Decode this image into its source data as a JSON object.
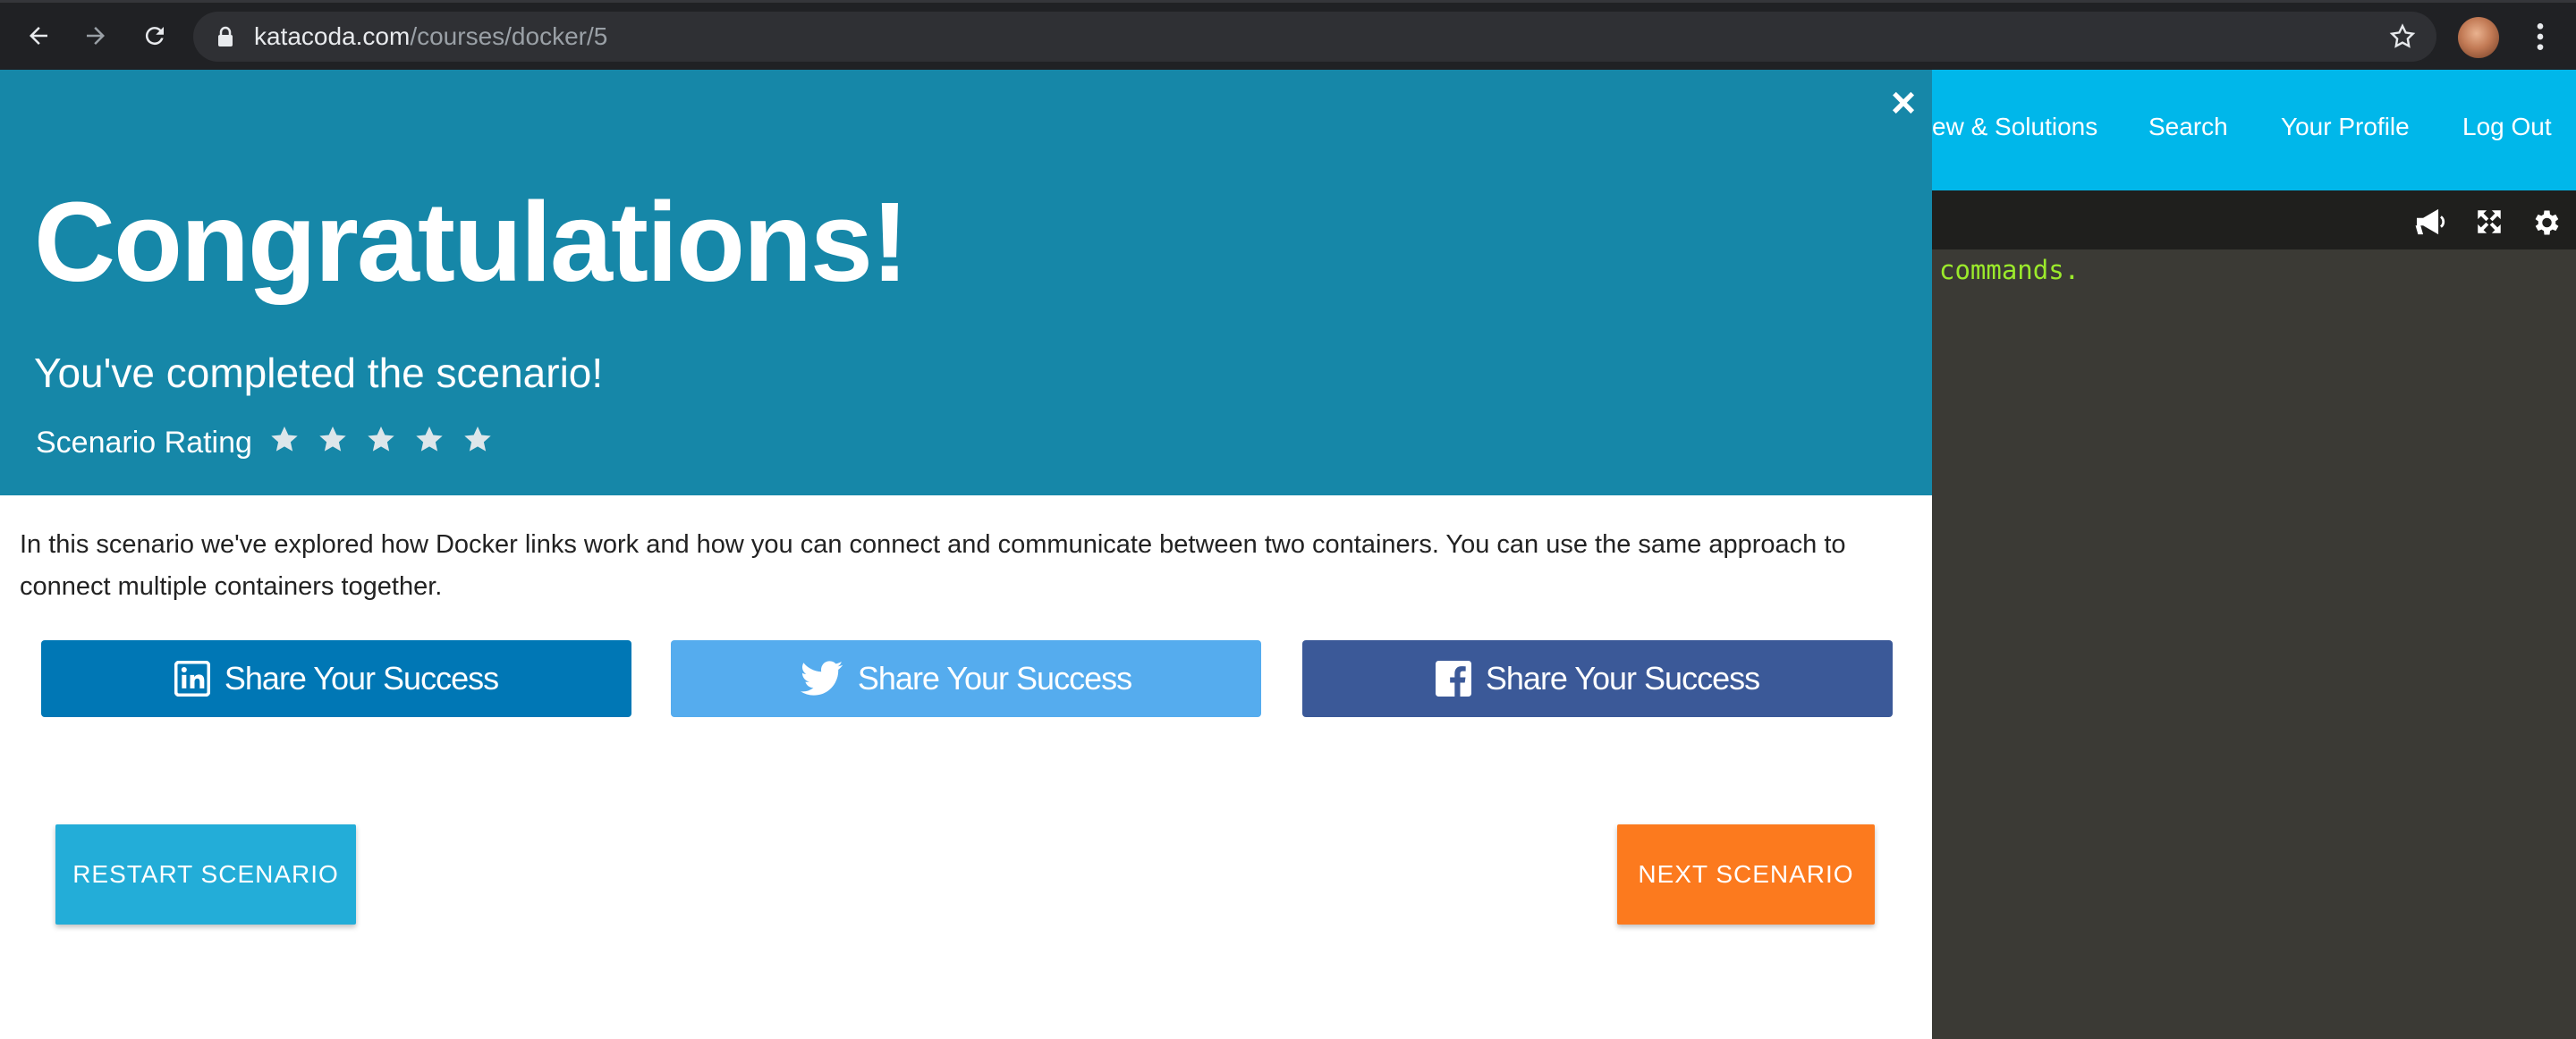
{
  "browser": {
    "url_domain": "katacoda.com",
    "url_path": "/courses/docker/5"
  },
  "app": {
    "nav": [
      "ew & Solutions",
      "Search",
      "Your Profile",
      "Log Out"
    ],
    "terminal_text": "commands.",
    "colors": {
      "header": "#00b7ea",
      "terminal_text": "#9bea2b"
    }
  },
  "modal": {
    "close_symbol": "×",
    "title": "Congratulations!",
    "subtitle": "You've completed the scenario!",
    "rating_label": "Scenario Rating",
    "rating_stars": 5,
    "description": "In this scenario we've explored how Docker links work and how you can connect and communicate between two containers. You can use the same approach to connect multiple containers together.",
    "share_buttons": [
      {
        "network": "linkedin-icon",
        "label": "Share Your Success",
        "color": "#0077b5"
      },
      {
        "network": "twitter-icon",
        "label": "Share Your Success",
        "color": "#55acee"
      },
      {
        "network": "facebook-icon",
        "label": "Share Your Success",
        "color": "#3b5998"
      }
    ],
    "restart_label": "RESTART SCENARIO",
    "next_label": "NEXT SCENARIO",
    "colors": {
      "header": "#1687a8",
      "restart": "#23add8",
      "next": "#fc7a1e"
    }
  }
}
